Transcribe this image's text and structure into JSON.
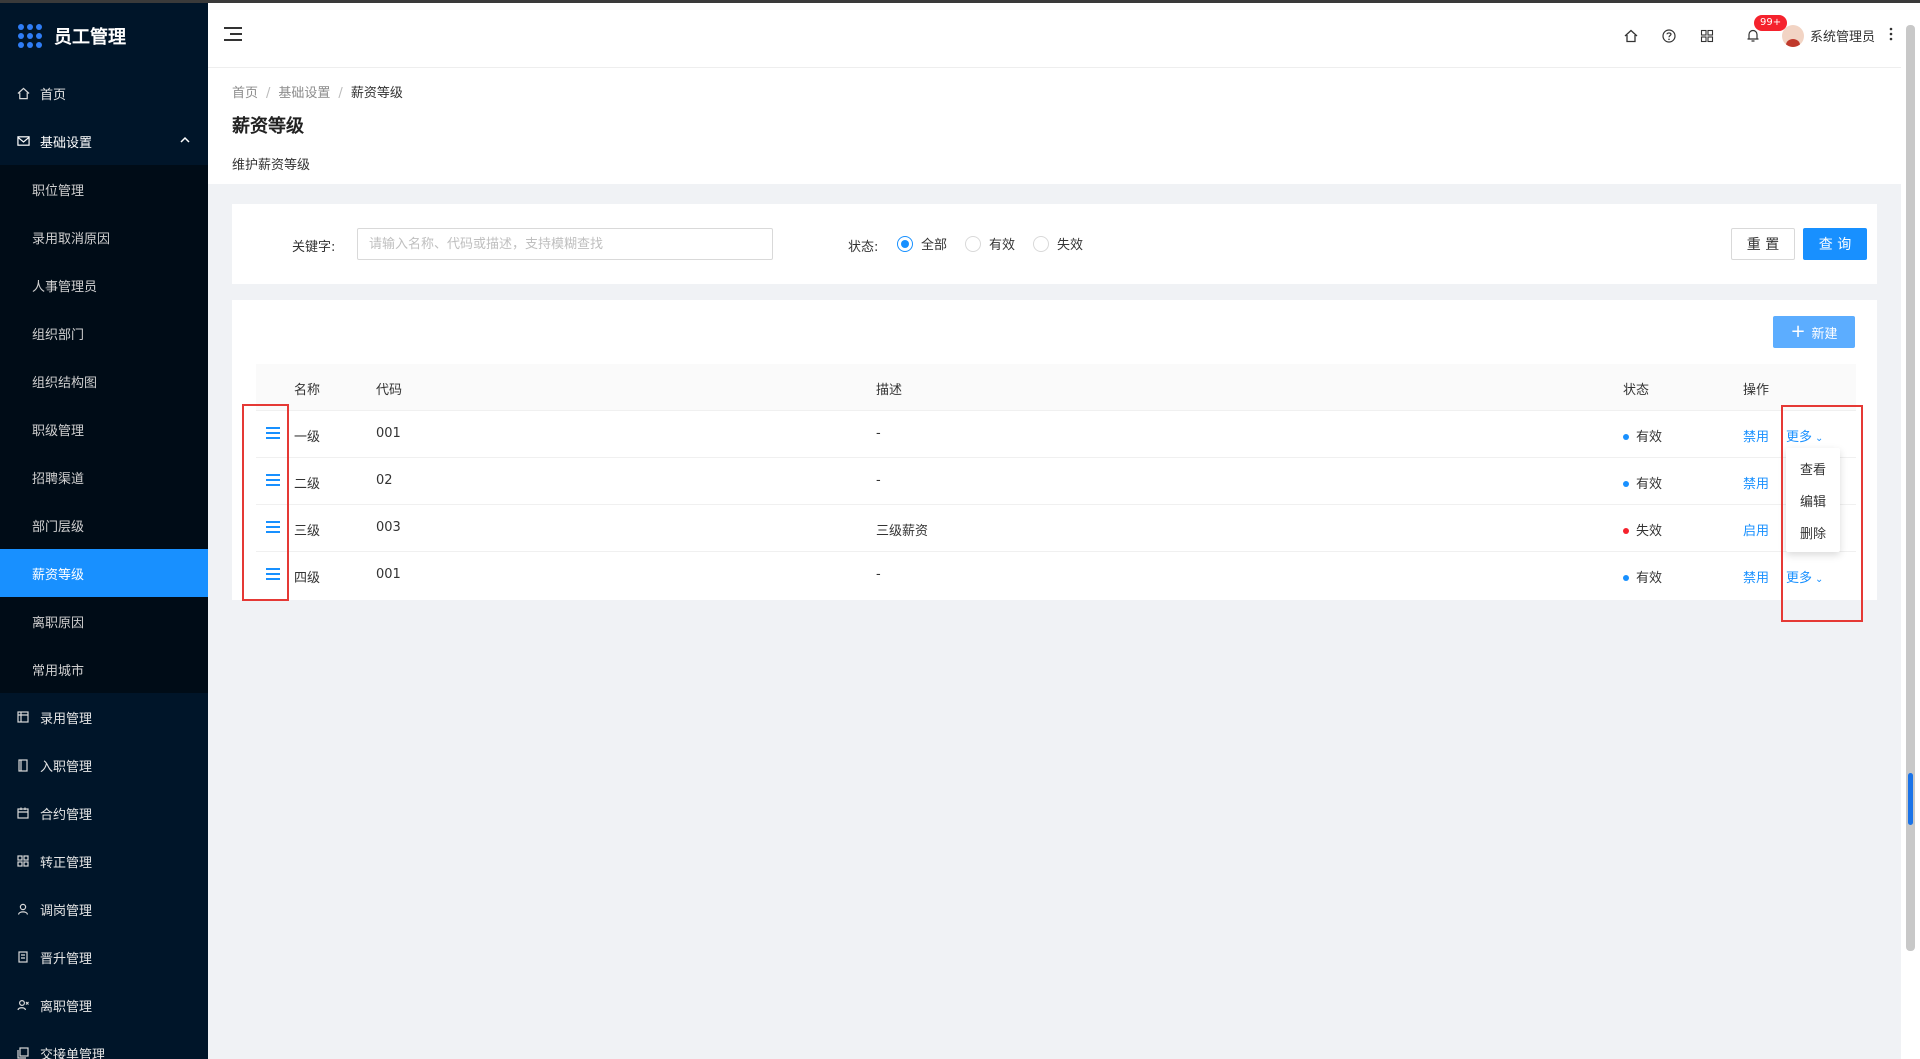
{
  "app": {
    "title": "员工管理"
  },
  "sidebar": {
    "home": "首页",
    "basic": {
      "label": "基础设置",
      "items": [
        "职位管理",
        "录用取消原因",
        "人事管理员",
        "组织部门",
        "组织结构图",
        "职级管理",
        "招聘渠道",
        "部门层级",
        "薪资等级",
        "离职原因",
        "常用城市"
      ],
      "active": "薪资等级"
    },
    "groups": [
      "录用管理",
      "入职管理",
      "合约管理",
      "转正管理",
      "调岗管理",
      "晋升管理",
      "离职管理",
      "交接单管理"
    ]
  },
  "header": {
    "badge": "99+",
    "user_name": "系统管理员",
    "icons": [
      "home-icon",
      "help-icon",
      "apps-icon",
      "bell-icon",
      "more-vertical-icon"
    ]
  },
  "page": {
    "breadcrumb": [
      "首页",
      "基础设置",
      "薪资等级"
    ],
    "title": "薪资等级",
    "description": "维护薪资等级"
  },
  "filter": {
    "keyword_label": "关键字:",
    "keyword_placeholder": "请输入名称、代码或描述，支持模糊查找",
    "keyword_value": "",
    "status_label": "状态:",
    "status_options": [
      "全部",
      "有效",
      "失效"
    ],
    "status_selected": "全部",
    "reset_label": "重 置",
    "query_label": "查 询"
  },
  "table": {
    "new_label": "新建",
    "columns": [
      "名称",
      "代码",
      "描述",
      "状态",
      "操作"
    ],
    "rows": [
      {
        "name": "一级",
        "code": "001",
        "desc": "-",
        "status": "有效",
        "action": "禁用",
        "more": "更多"
      },
      {
        "name": "二级",
        "code": "02",
        "desc": "-",
        "status": "有效",
        "action": "禁用",
        "more": ""
      },
      {
        "name": "三级",
        "code": "003",
        "desc": "三级薪资",
        "status": "失效",
        "action": "启用",
        "more": ""
      },
      {
        "name": "四级",
        "code": "001",
        "desc": "-",
        "status": "有效",
        "action": "禁用",
        "more": "更多"
      }
    ],
    "dropdown": [
      "查看",
      "编辑",
      "删除"
    ]
  },
  "colors": {
    "sidebar_bg": "#001529",
    "primary": "#1890ff",
    "status_valid": "#1890ff",
    "status_invalid": "#f5222d",
    "annotation": "#e53935"
  }
}
